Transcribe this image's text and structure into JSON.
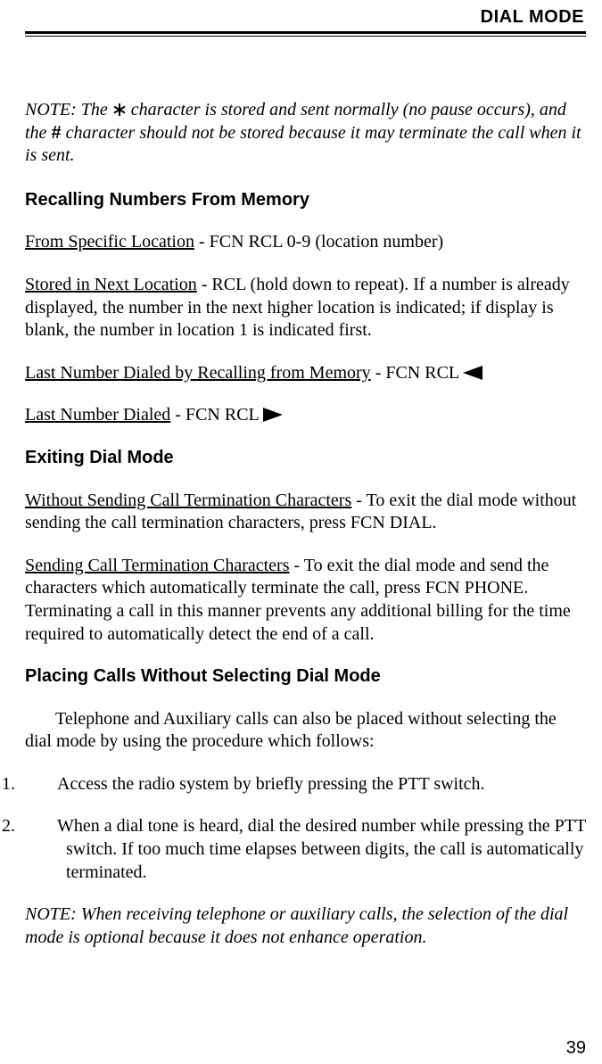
{
  "header": {
    "title": "DIAL MODE"
  },
  "note_top": {
    "lead": "NOTE: The ",
    "after_star": " character is stored and sent normally (no pause occurs), and the ",
    "hash": "#",
    "after_hash": " character should not be stored because it may terminate the call when it is sent."
  },
  "sections": {
    "recall": {
      "heading": "Recalling Numbers From Memory",
      "items": {
        "specific": {
          "label": "From Specific Location",
          "rest": " - FCN RCL 0-9 (location number)"
        },
        "next": {
          "label": "Stored in Next Location",
          "rest": " - RCL (hold down to repeat). If a number is already displayed, the number in the next higher location is indicated; if display is blank, the number in location 1 is indicated first."
        },
        "last_mem": {
          "label": "Last Number Dialed by Recalling from Memory",
          "rest": " - FCN RCL "
        },
        "last": {
          "label": "Last Number Dialed",
          "rest": " - FCN RCL  "
        }
      }
    },
    "exit": {
      "heading": "Exiting Dial Mode",
      "without": {
        "label": "Without Sending Call Termination Characters",
        "rest": " - To exit the dial mode without sending the call termination characters, press FCN DIAL."
      },
      "sending": {
        "label": "Sending Call Termination Characters",
        "rest": " - To exit the dial mode and send the characters which automatically terminate the call, press FCN PHONE. Terminating a call in this manner prevents any additional billing for the time required to automatically detect the end of a call."
      }
    },
    "placing": {
      "heading": "Placing Calls Without Selecting Dial Mode",
      "intro": "Telephone and Auxiliary calls can also be placed without selecting the dial mode by using the procedure which follows:",
      "steps": [
        {
          "n": "1.",
          "t": "Access the radio system by briefly pressing the PTT switch."
        },
        {
          "n": "2.",
          "t": "When a dial tone is heard, dial the desired number while pressing the PTT switch. If too much time elapses between digits, the call is automatically terminated."
        }
      ]
    }
  },
  "note_bottom": "NOTE: When receiving telephone or auxiliary calls, the selection of the dial mode is optional because it does not enhance operation.",
  "page_number": "39"
}
